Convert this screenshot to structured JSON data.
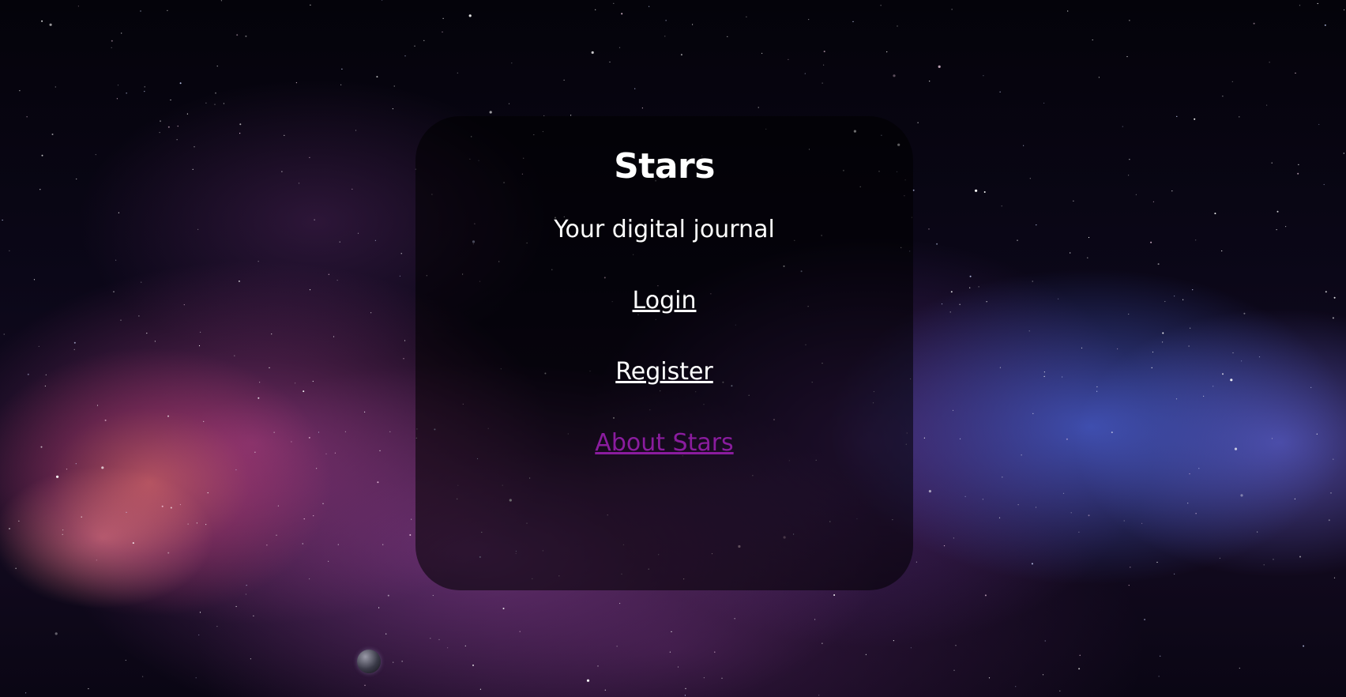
{
  "card": {
    "title": "Stars",
    "subtitle": "Your digital journal",
    "links": {
      "login": "Login",
      "register": "Register",
      "about": "About Stars"
    }
  },
  "colors": {
    "card_text": "#ffffff",
    "visited_link": "#8a1c9e"
  },
  "background": {
    "description_icon": "space-nebula-background"
  }
}
